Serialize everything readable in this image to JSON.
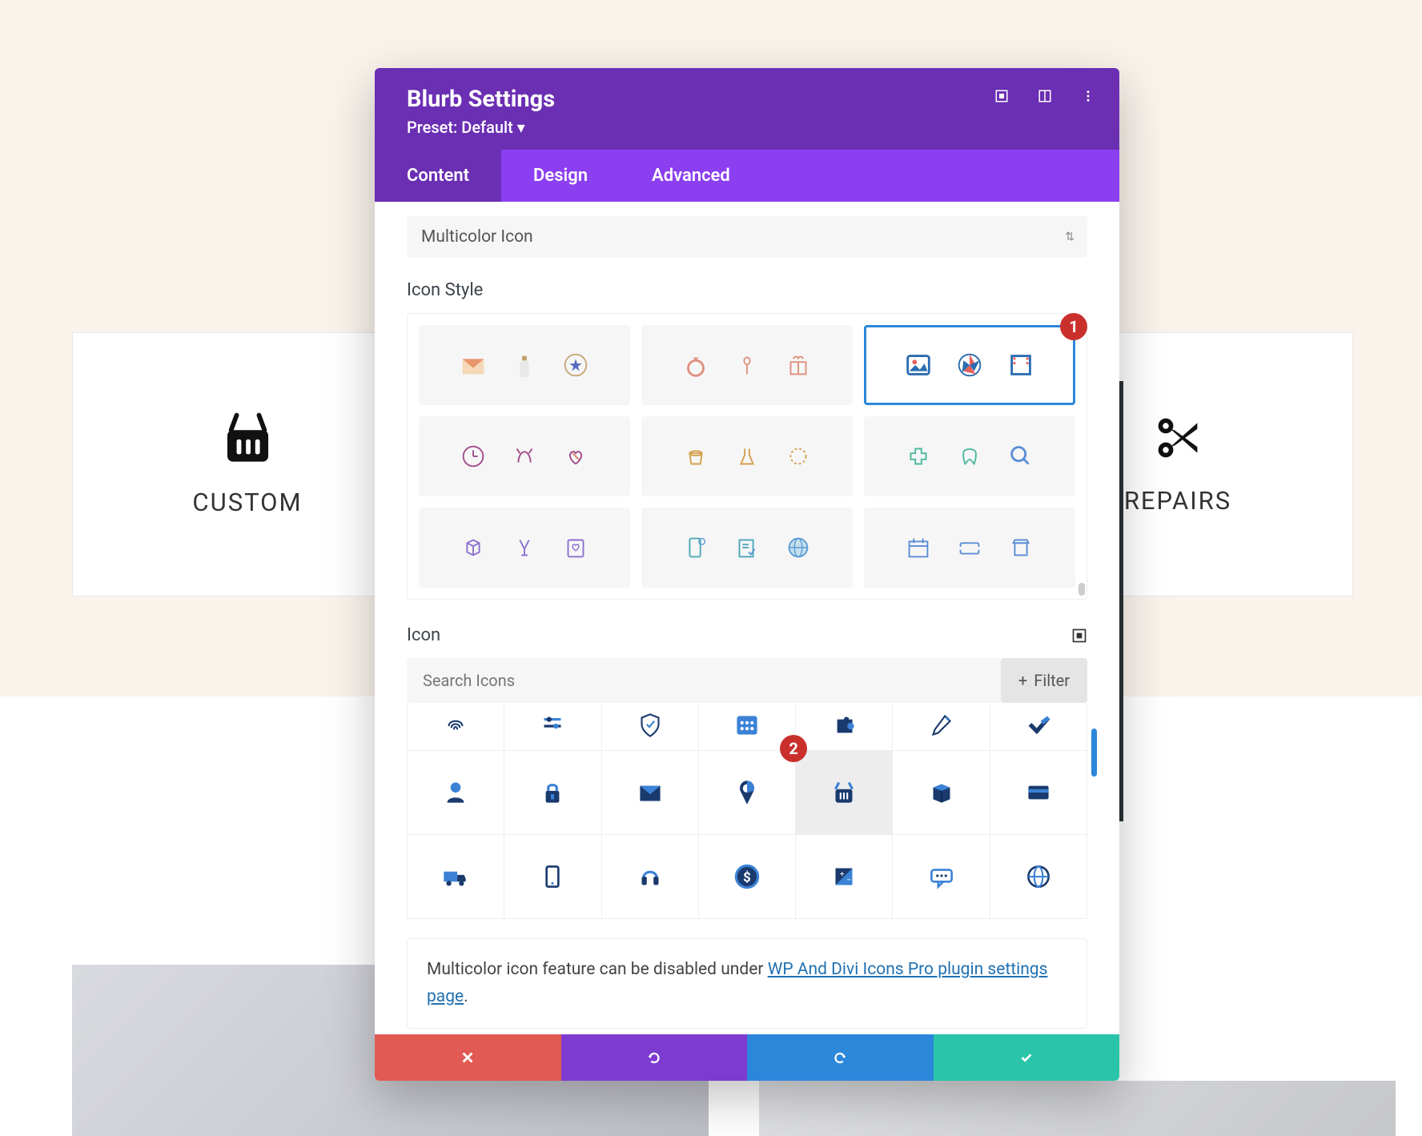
{
  "modal": {
    "title": "Blurb Settings",
    "preset": "Preset: Default ▾",
    "tabs": {
      "content": "Content",
      "design": "Design",
      "advanced": "Advanced"
    },
    "dropdown_value": "Multicolor Icon",
    "section_icon_style": "Icon Style",
    "section_icon": "Icon",
    "search_placeholder": "Search Icons",
    "filter_label": "Filter",
    "info_prefix": "Multicolor icon feature can be disabled under ",
    "info_link": "WP And Divi Icons Pro plugin settings page",
    "info_suffix": "."
  },
  "badges": {
    "one": "1",
    "two": "2"
  },
  "cards": {
    "left": "CUSTOM",
    "right": "REPAIRS"
  }
}
